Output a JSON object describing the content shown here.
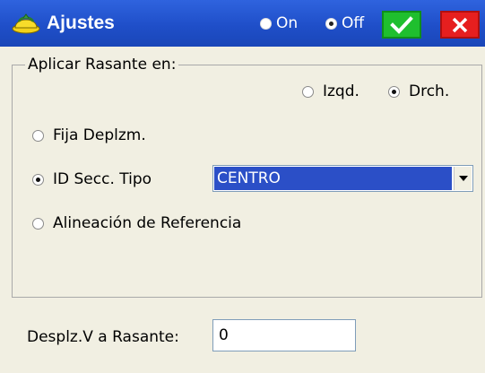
{
  "window": {
    "title": "Ajustes",
    "title_icon": "hard-hat-icon",
    "mode_on_label": "On",
    "mode_off_label": "Off",
    "mode_selected": "Off",
    "ok_icon": "checkmark-icon",
    "close_icon": "close-icon",
    "colors": {
      "titlebar": "#1f4fc9",
      "ok": "#1fbf2e",
      "close": "#e61f1f",
      "selection": "#2b4fc7",
      "background": "#f1efe2"
    }
  },
  "group": {
    "legend": "Aplicar Rasante en:",
    "side_left_label": "Izqd.",
    "side_right_label": "Drch.",
    "side_selected": "Drch.",
    "options": [
      {
        "label": "Fija Deplzm.",
        "checked": false
      },
      {
        "label": "ID Secc. Tipo",
        "checked": true
      },
      {
        "label": "Alineación de Referencia",
        "checked": false
      }
    ],
    "section_dropdown_value": "CENTRO"
  },
  "offset": {
    "label": "Desplz.V a Rasante:",
    "value": "0"
  }
}
